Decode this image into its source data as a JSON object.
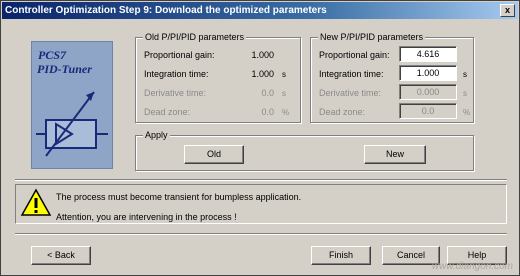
{
  "window": {
    "title": "Controller Optimization Step 9: Download the optimized parameters",
    "close_glyph": "x"
  },
  "logo": {
    "line1": "PCS7",
    "line2": "PID-Tuner"
  },
  "old_params": {
    "group_title": "Old P/PI/PID parameters",
    "rows": [
      {
        "label": "Proportional gain:",
        "value": "1.000",
        "unit": "",
        "enabled": true
      },
      {
        "label": "Integration time:",
        "value": "1.000",
        "unit": "s",
        "enabled": true
      },
      {
        "label": "Derivative time:",
        "value": "0.0",
        "unit": "s",
        "enabled": false
      },
      {
        "label": "Dead zone:",
        "value": "0.0",
        "unit": "%",
        "enabled": false
      }
    ]
  },
  "new_params": {
    "group_title": "New P/PI/PID parameters",
    "rows": [
      {
        "label": "Proportional gain:",
        "value": "4.616",
        "unit": "",
        "enabled": true
      },
      {
        "label": "Integration time:",
        "value": "1.000",
        "unit": "s",
        "enabled": true
      },
      {
        "label": "Derivative time:",
        "value": "0.000",
        "unit": "s",
        "enabled": false
      },
      {
        "label": "Dead zone:",
        "value": "0.0",
        "unit": "%",
        "enabled": false
      }
    ]
  },
  "apply": {
    "group_title": "Apply",
    "old_label": "Old",
    "new_label": "New"
  },
  "warning": {
    "line1": "The process must become transient for bumpless application.",
    "line2": "Attention, you are intervening in the process !"
  },
  "footer": {
    "back_label": "< Back",
    "finish_label": "Finish",
    "cancel_label": "Cancel",
    "help_label": "Help"
  },
  "watermark": "www.diangon.com",
  "colors": {
    "title_start": "#0a246a",
    "title_end": "#a6caf0",
    "logo_bg": "#8ea5c8",
    "warning_yellow": "#ffff00"
  }
}
